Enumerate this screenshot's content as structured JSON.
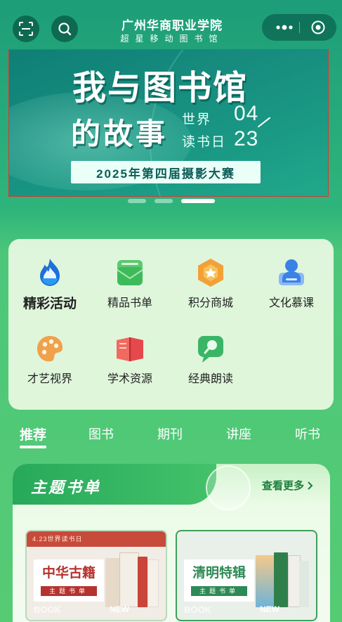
{
  "header": {
    "title": "广州华商职业学院",
    "subtitle": "超星移动图书馆"
  },
  "banner": {
    "line1": "我与图书馆",
    "line2": "的故事",
    "small1": "世界",
    "small2": "读书日",
    "num1": "04",
    "num2": "23",
    "strip": "2025年第四届摄影大赛",
    "slides": 3,
    "active_slide": 3
  },
  "menu": {
    "items": [
      {
        "label": "精彩活动",
        "icon": "flame-icon",
        "color": "#1e6fd9"
      },
      {
        "label": "精品书单",
        "icon": "book-list-icon",
        "color": "#3dbb59"
      },
      {
        "label": "积分商城",
        "icon": "points-store-icon",
        "color": "#f2a038"
      },
      {
        "label": "文化慕课",
        "icon": "mooc-icon",
        "color": "#3b82e6"
      },
      {
        "label": "才艺视界",
        "icon": "palette-icon",
        "color": "#f0a14a"
      },
      {
        "label": "学术资源",
        "icon": "academic-book-icon",
        "color": "#e5484d"
      },
      {
        "label": "经典朗读",
        "icon": "reading-icon",
        "color": "#3ab566"
      }
    ]
  },
  "tabs": [
    "推荐",
    "图书",
    "期刊",
    "讲座",
    "听书"
  ],
  "active_tab": "推荐",
  "theme": {
    "title": "主题书单",
    "more": "查看更多",
    "cards": [
      {
        "top_text": "4.23世界读书日",
        "name": "中华古籍",
        "sub": "主题书单",
        "new": "NEW",
        "book": "BOOK",
        "color": "#b5322e"
      },
      {
        "top_text": "",
        "name": "清明特辑",
        "sub": "主题书单",
        "new": "NEW",
        "book": "BOOK",
        "color": "#2e8a55"
      }
    ]
  }
}
